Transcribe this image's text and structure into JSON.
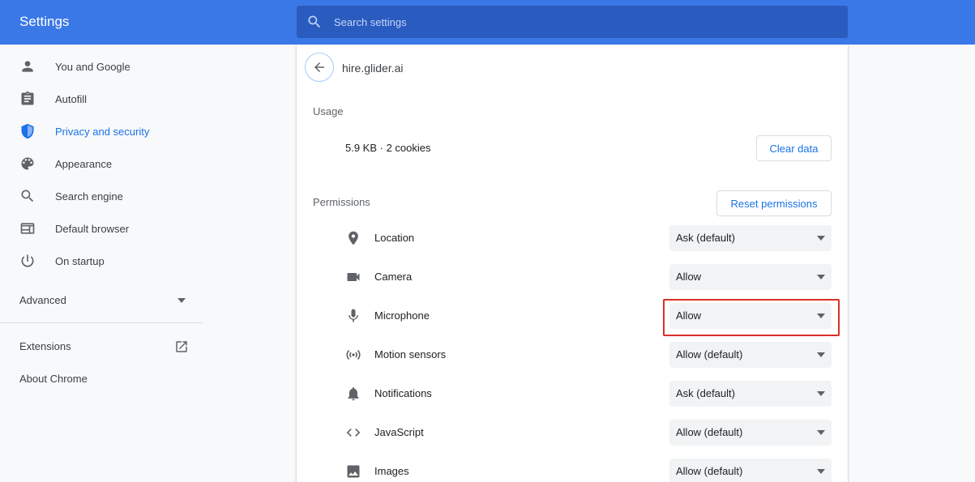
{
  "header": {
    "title": "Settings",
    "search_placeholder": "Search settings"
  },
  "sidebar": {
    "items": [
      {
        "label": "You and Google",
        "icon": "person-icon"
      },
      {
        "label": "Autofill",
        "icon": "clipboard-icon"
      },
      {
        "label": "Privacy and security",
        "icon": "shield-icon",
        "active": true
      },
      {
        "label": "Appearance",
        "icon": "palette-icon"
      },
      {
        "label": "Search engine",
        "icon": "search-icon"
      },
      {
        "label": "Default browser",
        "icon": "browser-window-icon"
      },
      {
        "label": "On startup",
        "icon": "power-icon"
      }
    ],
    "advanced_label": "Advanced",
    "extensions_label": "Extensions",
    "about_label": "About Chrome"
  },
  "site": {
    "name": "hire.glider.ai",
    "usage_heading": "Usage",
    "usage_text": "5.9 KB · 2 cookies",
    "clear_data_label": "Clear data",
    "permissions_heading": "Permissions",
    "reset_permissions_label": "Reset permissions",
    "permissions": [
      {
        "label": "Location",
        "value": "Ask (default)",
        "icon": "location-pin-icon"
      },
      {
        "label": "Camera",
        "value": "Allow",
        "icon": "camera-icon"
      },
      {
        "label": "Microphone",
        "value": "Allow",
        "icon": "microphone-icon",
        "highlighted": true
      },
      {
        "label": "Motion sensors",
        "value": "Allow (default)",
        "icon": "sensors-icon"
      },
      {
        "label": "Notifications",
        "value": "Ask (default)",
        "icon": "bell-icon"
      },
      {
        "label": "JavaScript",
        "value": "Allow (default)",
        "icon": "code-icon"
      },
      {
        "label": "Images",
        "value": "Allow (default)",
        "icon": "image-icon"
      }
    ]
  },
  "colors": {
    "header_bg": "#3b78e7",
    "accent": "#1a73e8",
    "highlight_border": "#d93025"
  }
}
